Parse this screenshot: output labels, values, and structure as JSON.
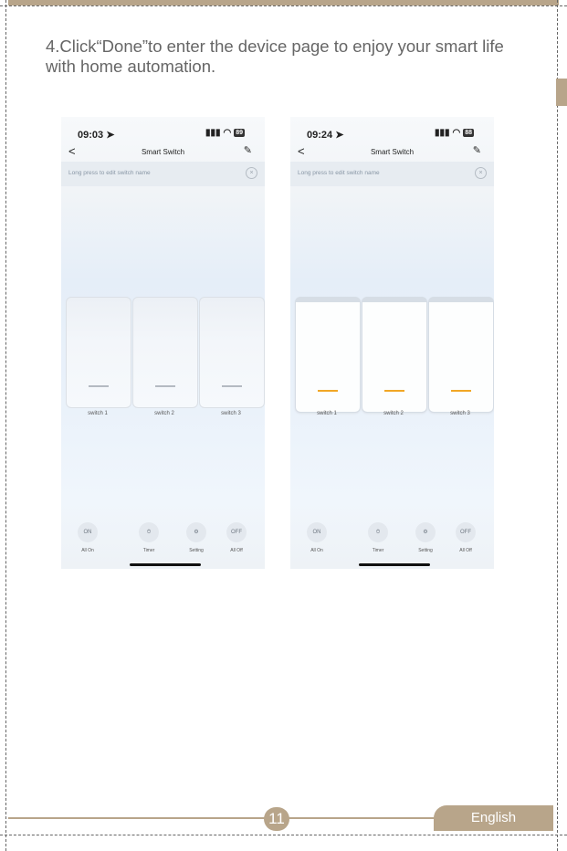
{
  "instruction": "4.Click“Done”to enter the device page to enjoy your smart life with home automation.",
  "screens": [
    {
      "time": "09:03",
      "battery": "89",
      "title": "Smart Switch",
      "hint": "Long press to edit switch name",
      "switches": [
        "switch 1",
        "switch 2",
        "switch 3"
      ],
      "state": "off",
      "actions": [
        {
          "icon": "ON",
          "label": "All On"
        },
        {
          "icon": "⏱",
          "label": "Timer"
        },
        {
          "icon": "⚙",
          "label": "Setting"
        },
        {
          "icon": "OFF",
          "label": "All Off"
        }
      ]
    },
    {
      "time": "09:24",
      "battery": "88",
      "title": "Smart Switch",
      "hint": "Long press to edit switch name",
      "switches": [
        "switch 1",
        "switch 2",
        "switch 3"
      ],
      "state": "on",
      "actions": [
        {
          "icon": "ON",
          "label": "All On"
        },
        {
          "icon": "⏱",
          "label": "Timer"
        },
        {
          "icon": "⚙",
          "label": "Setting"
        },
        {
          "icon": "OFF",
          "label": "All Off"
        }
      ]
    }
  ],
  "footer": {
    "page": "11",
    "language": "English"
  },
  "colors": {
    "accent": "#b8a58a",
    "switch_on": "#f1a726",
    "switch_off": "#b4bac2"
  }
}
